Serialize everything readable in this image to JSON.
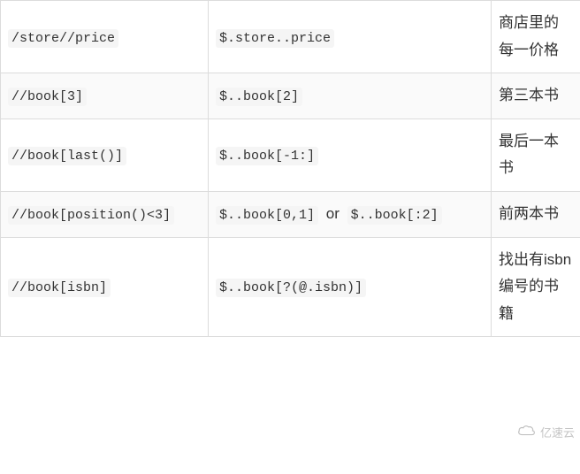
{
  "rows": [
    {
      "xpath": "/store//price",
      "jsonpath": "$.store..price",
      "jsonpath2": "",
      "or": "",
      "desc": "商店里的每一价格"
    },
    {
      "xpath": "//book[3]",
      "jsonpath": "$..book[2]",
      "jsonpath2": "",
      "or": "",
      "desc": "第三本书"
    },
    {
      "xpath": "//book[last()]",
      "jsonpath": "$..book[-1:]",
      "jsonpath2": "",
      "or": "",
      "desc": "最后一本书"
    },
    {
      "xpath": "//book[position()<3]",
      "jsonpath": "$..book[0,1]",
      "jsonpath2": "$..book[:2]",
      "or": "or",
      "desc": "前两本书"
    },
    {
      "xpath": "//book[isbn]",
      "jsonpath": "$..book[?(@.isbn)]",
      "jsonpath2": "",
      "or": "",
      "desc": "找出有isbn编号的书籍"
    }
  ],
  "watermark_text": "亿速云"
}
